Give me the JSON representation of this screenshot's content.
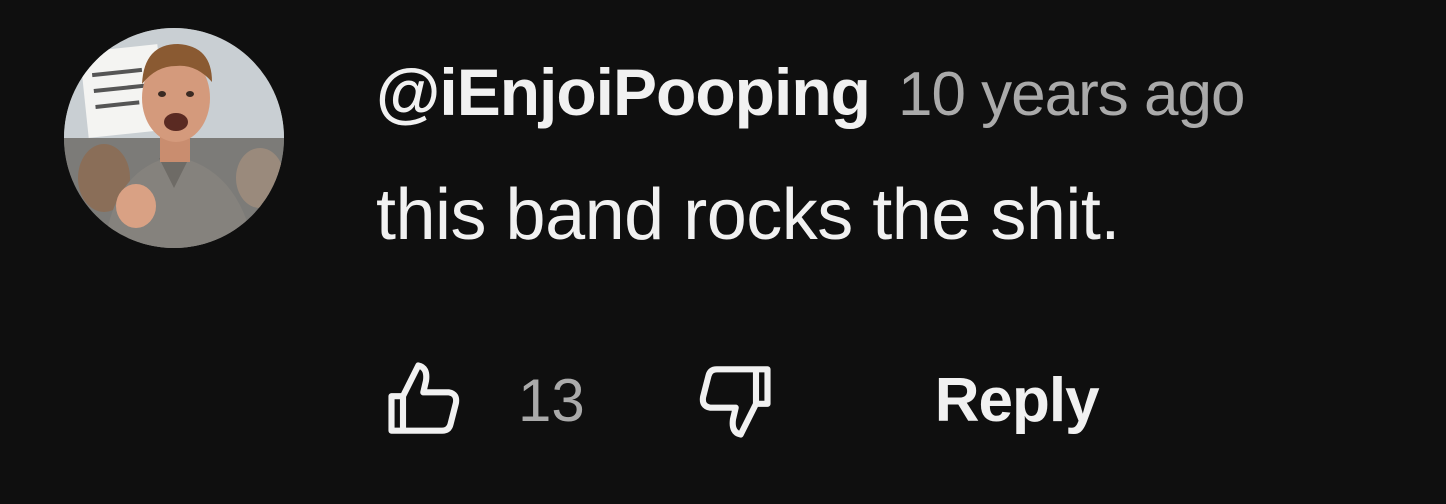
{
  "comment": {
    "author": "@iEnjoiPooping",
    "timestamp": "10 years ago",
    "text": "this band rocks the shit.",
    "like_count": "13",
    "reply_label": "Reply",
    "avatar_icon": "profile-photo",
    "like_icon": "thumbs-up-icon",
    "dislike_icon": "thumbs-down-icon"
  },
  "colors": {
    "background": "#0f0f0f",
    "primary_text": "#f1f1f1",
    "secondary_text": "#aaaaaa"
  }
}
